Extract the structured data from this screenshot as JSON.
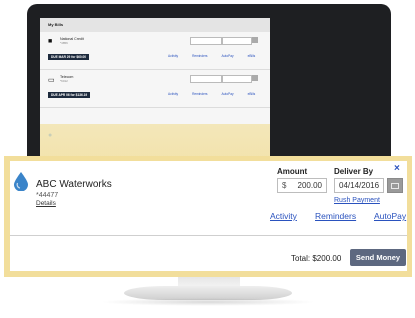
{
  "screen": {
    "heading": "My Bills",
    "bills": [
      {
        "name": "National Credit",
        "account": "*4856",
        "due": "DUE MAR 29 for $60.00",
        "links": [
          "Activity",
          "Reminders",
          "AutoPay",
          "eBills"
        ]
      },
      {
        "name": "Telecom",
        "account": "*6012",
        "due": "DUE APR 06 for $136.19",
        "links": [
          "Activity",
          "Reminders",
          "AutoPay",
          "eBills"
        ]
      }
    ]
  },
  "payment": {
    "payee_name": "ABC Waterworks",
    "account_number": "*44477",
    "details_label": "Details",
    "amount_label": "Amount",
    "currency_symbol": "$",
    "amount_value": "200.00",
    "deliver_by_label": "Deliver By",
    "deliver_by_value": "04/14/2016",
    "rush_payment_label": "Rush Payment",
    "close_glyph": "×",
    "activity_label": "Activity",
    "reminders_label": "Reminders",
    "autopay_label": "AutoPay",
    "total_text": "Total: $200.00",
    "send_label": "Send Money"
  },
  "colors": {
    "highlight": "#f2de9b",
    "link": "#2a52be",
    "button": "#5d6880",
    "monitor": "#1e1f22"
  },
  "icons": {
    "payee": "water-drop-icon",
    "calendar": "calendar-icon",
    "close": "close-icon"
  }
}
